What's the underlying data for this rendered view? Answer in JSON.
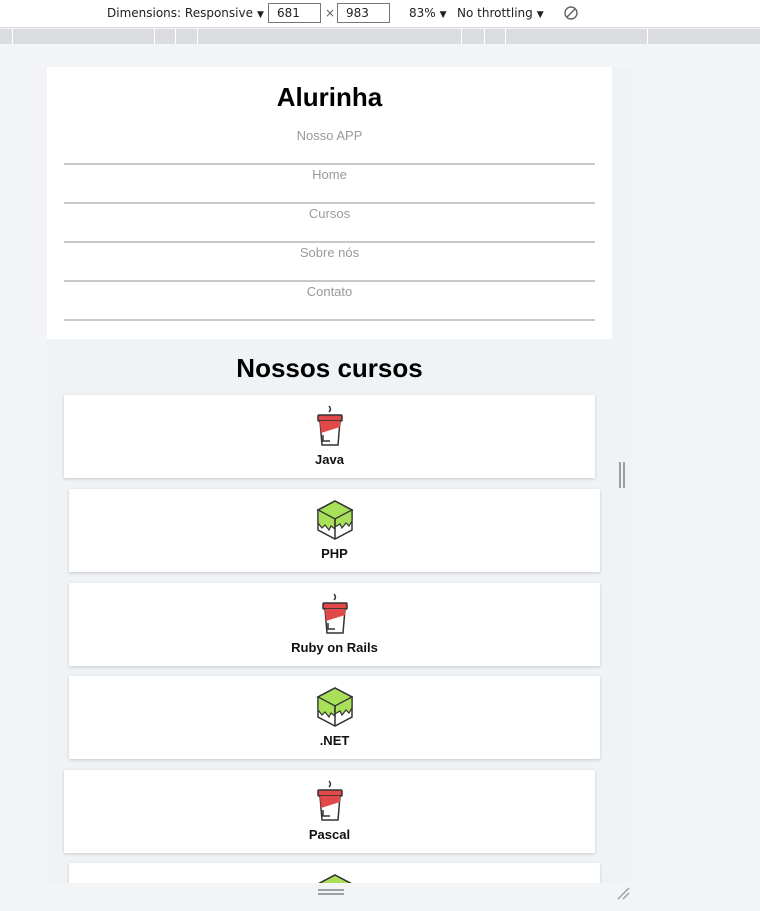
{
  "devtools": {
    "dimensions_label": "Dimensions: Responsive",
    "width": "681",
    "height": "983",
    "times": "×",
    "zoom": "83%",
    "throttling": "No throttling",
    "caret": "▼"
  },
  "header": {
    "title": "Alurinha",
    "nav": [
      "Nosso APP",
      "Home",
      "Cursos",
      "Sobre nós",
      "Contato"
    ]
  },
  "courses": {
    "title": "Nossos cursos",
    "items": [
      {
        "label": "Java",
        "icon": "coffee-cup-icon"
      },
      {
        "label": "PHP",
        "icon": "green-cube-icon"
      },
      {
        "label": "Ruby on Rails",
        "icon": "coffee-cup-icon"
      },
      {
        "label": ".NET",
        "icon": "green-cube-icon"
      },
      {
        "label": "Pascal",
        "icon": "coffee-cup-icon"
      },
      {
        "label": "",
        "icon": "green-cube-icon"
      }
    ]
  },
  "colors": {
    "cup_red": "#e0484a",
    "cube_green": "#a8e05a",
    "nav_text": "#9a9a9a",
    "page_bg": "#f0f3f6"
  }
}
